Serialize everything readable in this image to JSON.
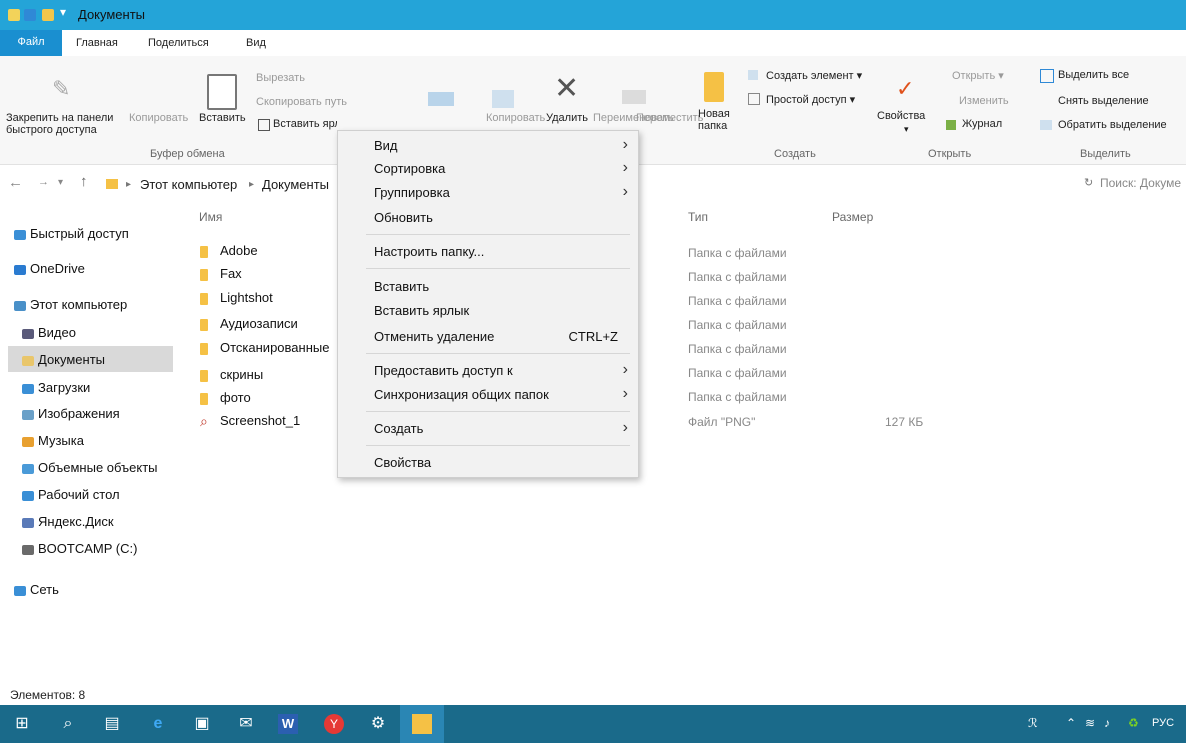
{
  "window": {
    "title": "Документы"
  },
  "ribbon_tabs": [
    "Файл",
    "Главная",
    "Поделиться",
    "Вид"
  ],
  "ribbon": {
    "clipboard": {
      "pin": "Закрепить на панели быстрого доступа",
      "pin_line1": "Закрепить на панели",
      "pin_line2": "быстрого доступа",
      "copy": "Копировать",
      "paste": "Вставить",
      "cut": "Вырезать",
      "copy_path": "Скопировать путь",
      "paste_shortcut": "Вставить ярлык",
      "group": "Буфер обмена"
    },
    "organize": {
      "move": "Переместить",
      "copy_to": "Копировать",
      "delete": "Удалить",
      "rename": "Переименовать"
    },
    "create": {
      "new_folder_1": "Новая",
      "new_folder_2": "папка",
      "new_item": "Создать элемент",
      "easy_access": "Простой доступ",
      "group": "Создать"
    },
    "open": {
      "properties": "Свойства",
      "open": "Открыть",
      "edit": "Изменить",
      "history": "Журнал",
      "group": "Открыть"
    },
    "select": {
      "select_all": "Выделить все",
      "select_none": "Снять выделение",
      "invert": "Обратить выделение",
      "group": "Выделить"
    }
  },
  "address": {
    "crumb1": "Этот компьютер",
    "crumb2": "Документы",
    "search_placeholder": "Поиск: Докуме"
  },
  "sidebar": [
    {
      "label": "Быстрый доступ",
      "color": "#3a8fd6"
    },
    {
      "label": "OneDrive",
      "color": "#2a7bd0"
    },
    {
      "label": "Этот компьютер",
      "color": "#4a90c8"
    },
    {
      "label": "Видео",
      "color": "#5a5a7a"
    },
    {
      "label": "Документы",
      "color": "#e9c66b"
    },
    {
      "label": "Загрузки",
      "color": "#3a8fd6"
    },
    {
      "label": "Изображения",
      "color": "#6aa0c8"
    },
    {
      "label": "Музыка",
      "color": "#e8a030"
    },
    {
      "label": "Объемные объекты",
      "color": "#4a9ad8"
    },
    {
      "label": "Рабочий стол",
      "color": "#3a8fd6"
    },
    {
      "label": "Яндекс.Диск",
      "color": "#5a7ab8"
    },
    {
      "label": "BOOTCAMP (C:)",
      "color": "#6a6a6a"
    },
    {
      "label": "Сеть",
      "color": "#3a8fd6"
    }
  ],
  "columns": {
    "name": "Имя",
    "type": "Тип",
    "size": "Размер"
  },
  "files": [
    {
      "name": "Adobe",
      "type": "Папка с файлами",
      "size": ""
    },
    {
      "name": "Fax",
      "type": "Папка с файлами",
      "size": ""
    },
    {
      "name": "Lightshot",
      "type": "Папка с файлами",
      "size": ""
    },
    {
      "name": "Аудиозаписи",
      "type": "Папка с файлами",
      "size": ""
    },
    {
      "name": "Отсканированные",
      "type": "Папка с файлами",
      "size": ""
    },
    {
      "name": "скрины",
      "type": "Папка с файлами",
      "size": ""
    },
    {
      "name": "фото",
      "type": "Папка с файлами",
      "size": ""
    },
    {
      "name": "Screenshot_1",
      "type": "Файл \"PNG\"",
      "size": "127 КБ"
    }
  ],
  "context_menu": {
    "view": "Вид",
    "sort": "Сортировка",
    "group": "Группировка",
    "refresh": "Обновить",
    "customize": "Настроить папку...",
    "paste": "Вставить",
    "paste_shortcut": "Вставить ярлык",
    "undo_delete": "Отменить удаление",
    "undo_shortcut": "CTRL+Z",
    "share": "Предоставить доступ к",
    "sync": "Синхронизация общих папок",
    "create": "Создать",
    "properties": "Свойства"
  },
  "status": {
    "count": "Элементов: 8"
  },
  "taskbar": {
    "lang": "РУС"
  },
  "colors": {
    "titlebar": "#24a4d8",
    "taskbar": "#1a6a8a",
    "file_tab": "#1a8fd0"
  }
}
